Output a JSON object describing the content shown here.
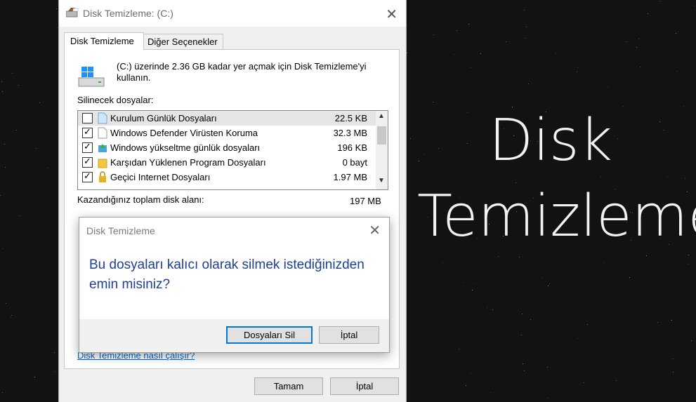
{
  "window": {
    "title": "Disk Temizleme:   (C:)",
    "close_glyph": "✕"
  },
  "tabs": [
    {
      "label": "Disk Temizleme"
    },
    {
      "label": "Diğer Seçenekler"
    }
  ],
  "intro_text": "(C:) üzerinde 2.36 GB kadar yer açmak için Disk Temizleme'yi kullanın.",
  "list_label": "Silinecek dosyalar:",
  "files": [
    {
      "name": "Kurulum Günlük Dosyaları",
      "size": "22.5 KB",
      "checked": false
    },
    {
      "name": "Windows Defender Virüsten Koruma",
      "size": "32.3 MB",
      "checked": true
    },
    {
      "name": "Windows yükseltme günlük dosyaları",
      "size": "196 KB",
      "checked": true
    },
    {
      "name": "Karşıdan Yüklenen Program Dosyaları",
      "size": "0 bayt",
      "checked": true
    },
    {
      "name": "Geçici Internet Dosyaları",
      "size": "1.97 MB",
      "checked": true
    }
  ],
  "gain": {
    "label": "Kazandığınız toplam disk alanı:",
    "value": "197 MB"
  },
  "help_link": "Disk Temizleme nasıl çalışır?",
  "buttons": {
    "ok": "Tamam",
    "cancel": "İptal"
  },
  "dialog": {
    "title": "Disk Temizleme",
    "close_glyph": "✕",
    "message": "Bu dosyaları kalıcı olarak silmek istediğinizden emin misiniz?",
    "delete_label": "Dosyaları Sil",
    "cancel_label": "İptal"
  },
  "hero": {
    "line1": "Disk",
    "line2": "Temizleme"
  },
  "colors": {
    "dialog_message": "#1e3f92",
    "link": "#0066cc",
    "focus": "#0078d7"
  }
}
